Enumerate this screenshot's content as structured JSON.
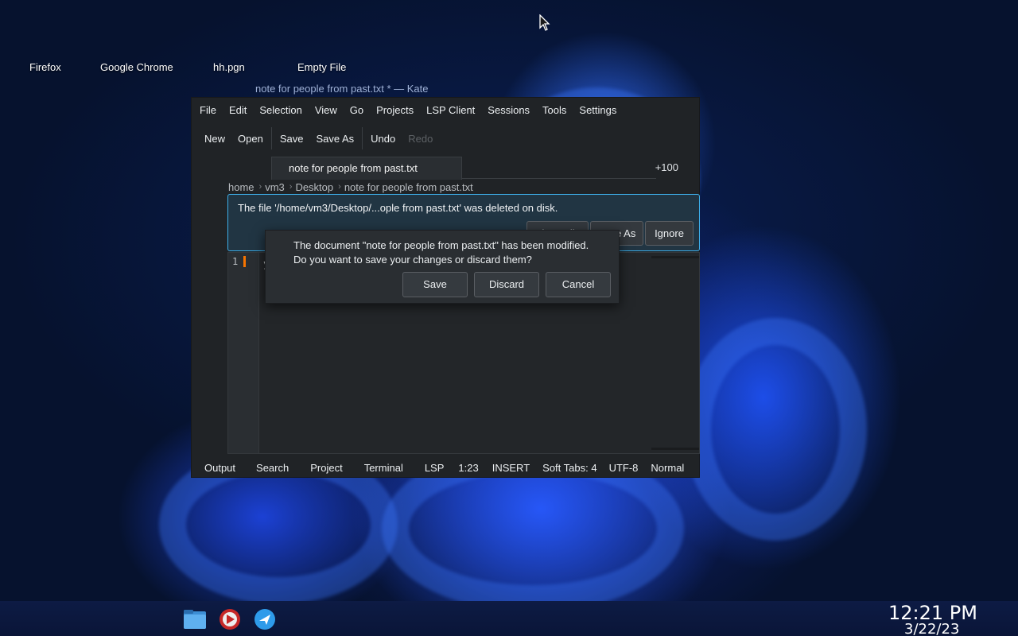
{
  "desktop": {
    "icons": [
      "Firefox",
      "Google Chrome",
      "hh.pgn",
      "Empty File"
    ],
    "window_title": "note for people from past.txt * — Kate"
  },
  "kate": {
    "menu": [
      "File",
      "Edit",
      "Selection",
      "View",
      "Go",
      "Projects",
      "LSP Client",
      "Sessions",
      "Tools",
      "Settings"
    ],
    "toolbar": {
      "new": "New",
      "open": "Open",
      "save": "Save",
      "save_as": "Save As",
      "undo": "Undo",
      "redo": "Redo"
    },
    "tab": {
      "label": "note for people from past.txt",
      "count": "+100"
    },
    "breadcrumb": [
      "home",
      "vm3",
      "Desktop",
      "note for people from past.txt"
    ],
    "notice": {
      "text": "The file '/home/vm3/Desktop/...ople from past.txt' was deleted on disk.",
      "close_file": "Close File",
      "save_as": "Save As",
      "ignore": "Ignore"
    },
    "editor": {
      "line_number": "1",
      "line_text": "y"
    },
    "status": {
      "output": "Output",
      "search": "Search",
      "project": "Project",
      "terminal": "Terminal",
      "lsp": "LSP",
      "position": "1:23",
      "mode": "INSERT",
      "tabs": "Soft Tabs: 4",
      "encoding": "UTF-8",
      "syntax": "Normal"
    }
  },
  "dialog": {
    "line1": "The document \"note for people from past.txt\" has been modified.",
    "line2": "Do you want to save your changes or discard them?",
    "save": "Save",
    "discard": "Discard",
    "cancel": "Cancel"
  },
  "taskbar": {
    "icons": [
      "folder-icon",
      "media-player-icon",
      "kde-connect-icon"
    ],
    "time": "12:21 PM",
    "date": "3/22/23"
  },
  "colors": {
    "accent": "#3daee9",
    "modified_marker": "#f67400"
  }
}
